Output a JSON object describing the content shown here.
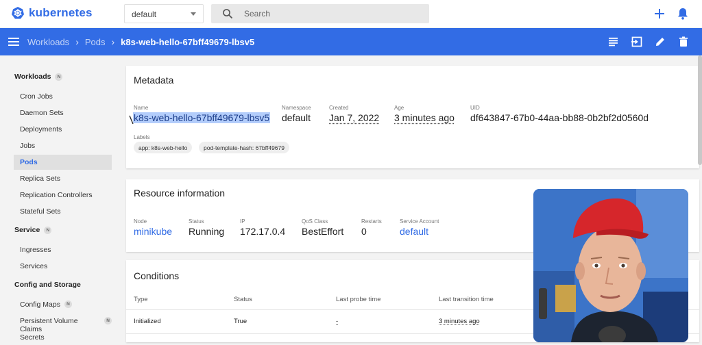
{
  "app": {
    "brand": "kubernetes"
  },
  "topbar": {
    "namespace": "default",
    "search_placeholder": "Search"
  },
  "breadcrumb": {
    "items": [
      "Workloads",
      "Pods"
    ],
    "current": "k8s-web-hello-67bff49679-lbsv5"
  },
  "sidebar": {
    "sections": [
      {
        "title": "Workloads",
        "badge": "N",
        "items": [
          "Cron Jobs",
          "Daemon Sets",
          "Deployments",
          "Jobs",
          "Pods",
          "Replica Sets",
          "Replication Controllers",
          "Stateful Sets"
        ]
      },
      {
        "title": "Service",
        "badge": "N",
        "items": [
          "Ingresses",
          "Services"
        ]
      },
      {
        "title": "Config and Storage",
        "items": [
          "Config Maps",
          "Persistent Volume Claims",
          "Secrets"
        ],
        "item_badges": [
          "N",
          "N",
          ""
        ]
      }
    ],
    "active_item": "Pods"
  },
  "metadata": {
    "title": "Metadata",
    "name_label": "Name",
    "name": "k8s-web-hello-67bff49679-lbsv5",
    "namespace_label": "Namespace",
    "namespace": "default",
    "created_label": "Created",
    "created": "Jan 7, 2022",
    "age_label": "Age",
    "age": "3 minutes ago",
    "uid_label": "UID",
    "uid": "df643847-67b0-44aa-bb88-0b2bf2d0560d",
    "labels_label": "Labels",
    "labels": [
      "app: k8s-web-hello",
      "pod-template-hash: 67bff49679"
    ]
  },
  "resource": {
    "title": "Resource information",
    "node_label": "Node",
    "node": "minikube",
    "status_label": "Status",
    "status": "Running",
    "ip_label": "IP",
    "ip": "172.17.0.4",
    "qos_label": "QoS Class",
    "qos": "BestEffort",
    "restarts_label": "Restarts",
    "restarts": "0",
    "sa_label": "Service Account",
    "sa": "default"
  },
  "conditions": {
    "title": "Conditions",
    "headers": [
      "Type",
      "Status",
      "Last probe time",
      "Last transition time"
    ],
    "rows": [
      [
        "Initialized",
        "True",
        "-",
        "3 minutes ago"
      ]
    ]
  },
  "colors": {
    "brand": "#326ce5",
    "nav": "#326ce5"
  }
}
